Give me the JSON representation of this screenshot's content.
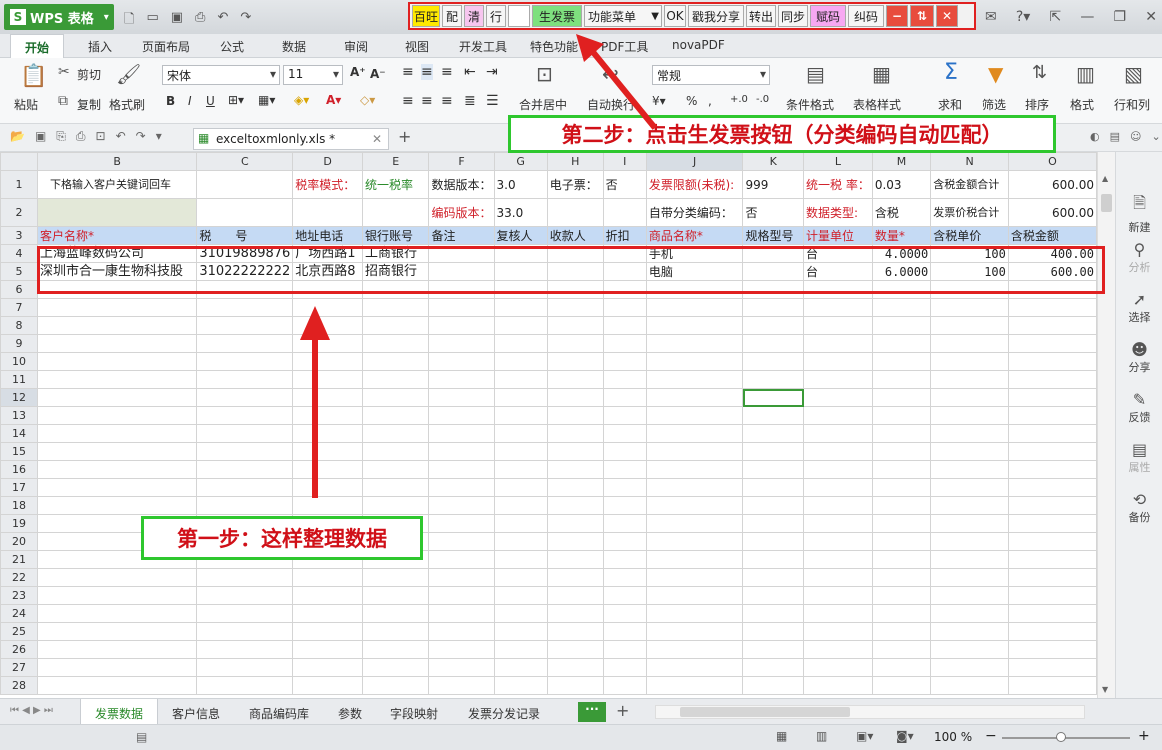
{
  "app": {
    "title": "WPS 表格",
    "logo": "S"
  },
  "plugin_bar": {
    "buttons": [
      "百旺",
      "配",
      "清",
      "行",
      "生发票",
      "功能菜单",
      "OK",
      "戳我分享",
      "转出",
      "同步",
      "赋码",
      "纠码"
    ]
  },
  "ribbon_tabs": [
    "开始",
    "插入",
    "页面布局",
    "公式",
    "数据",
    "审阅",
    "视图",
    "开发工具",
    "特色功能",
    "PDF工具",
    "novaPDF"
  ],
  "ribbon": {
    "paste": "粘贴",
    "cut": "剪切",
    "copy": "复制",
    "format_painter": "格式刷",
    "font_name": "宋体",
    "font_size": "11",
    "merge_center": "合并居中",
    "wrap_text": "自动换行",
    "number_format": "常规",
    "cond_format": "条件格式",
    "table_style": "表格样式",
    "sum": "求和",
    "filter": "筛选",
    "sort": "排序",
    "format": "格式",
    "rows_cols": "行和列"
  },
  "document": {
    "filename": "exceltoxmlonly.xls *"
  },
  "columns": [
    "B",
    "C",
    "D",
    "E",
    "F",
    "G",
    "H",
    "I",
    "J",
    "K",
    "L",
    "M",
    "N",
    "O"
  ],
  "rows": {
    "r1": [
      "下格输入客户关键词回车",
      "",
      "税率模式：",
      "统一税率",
      "数据版本：",
      "3.0",
      "电子票：",
      "否",
      "发票限额(未税):",
      "999",
      "统一税 率：",
      "0.03",
      "含税金额合计",
      "600.00"
    ],
    "r2": [
      "",
      "",
      "",
      "",
      "编码版本：",
      "33.0",
      "",
      "",
      "自带分类编码：",
      "否",
      "数据类型:",
      "含税",
      "发票价税合计",
      "600.00"
    ],
    "r3": [
      "客户名称*",
      "税　　号",
      "地址电话",
      "银行账号",
      "备注",
      "复核人",
      "收款人",
      "折扣",
      "商品名称*",
      "规格型号",
      "计量单位",
      "数量*",
      "含税单价",
      "含税金额"
    ],
    "r4": [
      "上海蓝峰数码公司",
      "31019889876",
      "广场西路1",
      "工商银行",
      "",
      "",
      "",
      "",
      "手机",
      "",
      "台",
      "4.0000",
      "100",
      "400.00"
    ],
    "r5": [
      "深圳市合一康生物科技股",
      "31022222222",
      "北京西路8",
      "招商银行",
      "",
      "",
      "",
      "",
      "电脑",
      "",
      "台",
      "6.0000",
      "100",
      "600.00"
    ]
  },
  "sheet_tabs": [
    "发票数据",
    "客户信息",
    "商品编码库",
    "参数",
    "字段映射",
    "发票分发记录"
  ],
  "right_panel": [
    "新建",
    "分析",
    "选择",
    "分享",
    "反馈",
    "属性",
    "备份"
  ],
  "status": {
    "zoom": "100 %"
  },
  "annotations": {
    "step1": "第一步：这样整理数据",
    "step2": "第二步：点击生发票按钮（分类编码自动匹配）"
  },
  "colors": {
    "accent_green": "#3a9a37",
    "callout_red": "#e02020",
    "callout_green": "#2ec72e",
    "header_blue": "#c5daf4"
  }
}
